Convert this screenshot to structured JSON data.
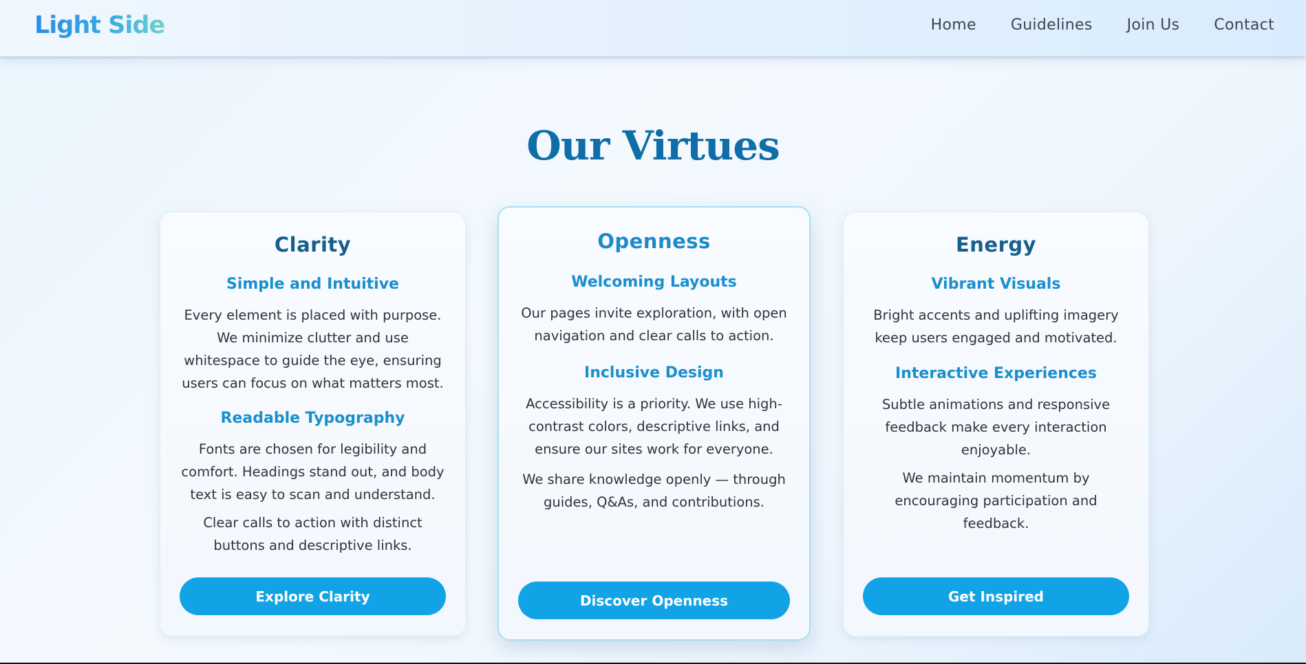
{
  "header": {
    "logo": "Light Side",
    "nav": [
      "Home",
      "Guidelines",
      "Join Us",
      "Contact"
    ]
  },
  "section": {
    "title": "Our Virtues"
  },
  "cards": [
    {
      "title": "Clarity",
      "sub1": "Simple and Intuitive",
      "p1": "Every element is placed with purpose. We minimize clutter and use whitespace to guide the eye, ensuring users can focus on what matters most.",
      "sub2": "Readable Typography",
      "p2": "Fonts are chosen for legibility and comfort. Headings stand out, and body text is easy to scan and understand.",
      "p3": "Clear calls to action with distinct buttons and descriptive links.",
      "button": "Explore Clarity"
    },
    {
      "title": "Openness",
      "sub1": "Welcoming Layouts",
      "p1": "Our pages invite exploration, with open navigation and clear calls to action.",
      "sub2": "Inclusive Design",
      "p2": "Accessibility is a priority. We use high-contrast colors, descriptive links, and ensure our sites work for everyone.",
      "p3": "We share knowledge openly — through guides, Q&As, and contributions.",
      "button": "Discover Openness"
    },
    {
      "title": "Energy",
      "sub1": "Vibrant Visuals",
      "p1": "Bright accents and uplifting imagery keep users engaged and motivated.",
      "sub2": "Interactive Experiences",
      "p2": "Subtle animations and responsive feedback make every interaction enjoyable.",
      "p3": "We maintain momentum by encouraging participation and feedback.",
      "button": "Get Inspired"
    }
  ],
  "colors": {
    "accent": "#12a3e6",
    "heading": "#0f6ea8",
    "subheading": "#1a8fcc"
  }
}
